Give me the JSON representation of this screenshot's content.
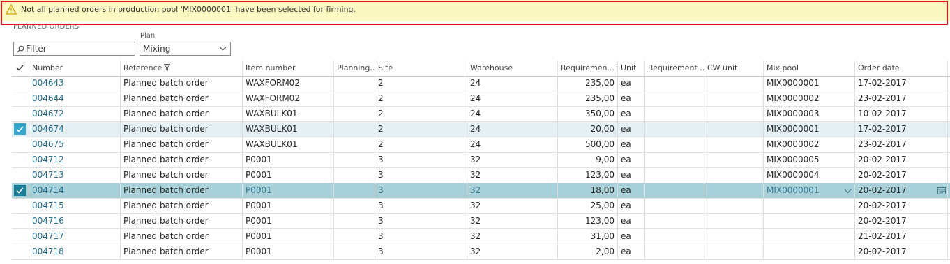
{
  "banner": {
    "message": "Not all planned orders in production pool 'MIX0000001' have been selected for firming."
  },
  "section_title": "PLANNED ORDERS",
  "filter": {
    "placeholder": "Filter",
    "value": ""
  },
  "plan": {
    "label": "Plan",
    "value": "Mixing"
  },
  "columns": {
    "number": "Number",
    "reference": "Reference",
    "item_number": "Item number",
    "planning": "Planning...",
    "site": "Site",
    "warehouse": "Warehouse",
    "requirement_qty": "Requiremen...",
    "unit": "Unit",
    "requirement_date": "Requirement ...",
    "cw_unit": "CW unit",
    "mix_pool": "Mix pool",
    "order_date": "Order date"
  },
  "rows": [
    {
      "number": "004643",
      "reference": "Planned batch order",
      "item": "WAXFORM02",
      "planning": "",
      "site": "2",
      "warehouse": "24",
      "qty": "235,00",
      "unit": "ea",
      "req": "",
      "cw": "",
      "mix": "MIX0000001",
      "date": "17-02-2017",
      "selected": false
    },
    {
      "number": "004644",
      "reference": "Planned batch order",
      "item": "WAXFORM02",
      "planning": "",
      "site": "2",
      "warehouse": "24",
      "qty": "235,00",
      "unit": "ea",
      "req": "",
      "cw": "",
      "mix": "MIX0000002",
      "date": "23-02-2017",
      "selected": false
    },
    {
      "number": "004672",
      "reference": "Planned batch order",
      "item": "WAXBULK01",
      "planning": "",
      "site": "2",
      "warehouse": "24",
      "qty": "350,00",
      "unit": "ea",
      "req": "",
      "cw": "",
      "mix": "MIX0000003",
      "date": "10-02-2017",
      "selected": false
    },
    {
      "number": "004674",
      "reference": "Planned batch order",
      "item": "WAXBULK01",
      "planning": "",
      "site": "2",
      "warehouse": "24",
      "qty": "20,00",
      "unit": "ea",
      "req": "",
      "cw": "",
      "mix": "MIX0000001",
      "date": "17-02-2017",
      "selected": true
    },
    {
      "number": "004675",
      "reference": "Planned batch order",
      "item": "WAXBULK01",
      "planning": "",
      "site": "2",
      "warehouse": "24",
      "qty": "500,00",
      "unit": "ea",
      "req": "",
      "cw": "",
      "mix": "MIX0000002",
      "date": "23-02-2017",
      "selected": false
    },
    {
      "number": "004712",
      "reference": "Planned batch order",
      "item": "P0001",
      "planning": "",
      "site": "3",
      "warehouse": "32",
      "qty": "9,00",
      "unit": "ea",
      "req": "",
      "cw": "",
      "mix": "MIX0000005",
      "date": "20-02-2017",
      "selected": false
    },
    {
      "number": "004713",
      "reference": "Planned batch order",
      "item": "P0001",
      "planning": "",
      "site": "3",
      "warehouse": "32",
      "qty": "123,00",
      "unit": "ea",
      "req": "",
      "cw": "",
      "mix": "MIX0000004",
      "date": "20-02-2017",
      "selected": false
    },
    {
      "number": "004714",
      "reference": "Planned batch order",
      "item": "P0001",
      "planning": "",
      "site": "3",
      "warehouse": "32",
      "qty": "18,00",
      "unit": "ea",
      "req": "",
      "cw": "",
      "mix": "MIX0000001",
      "date": "20-02-2017",
      "selected": true,
      "active": true
    },
    {
      "number": "004715",
      "reference": "Planned batch order",
      "item": "P0001",
      "planning": "",
      "site": "3",
      "warehouse": "32",
      "qty": "25,00",
      "unit": "ea",
      "req": "",
      "cw": "",
      "mix": "",
      "date": "20-02-2017",
      "selected": false
    },
    {
      "number": "004716",
      "reference": "Planned batch order",
      "item": "P0001",
      "planning": "",
      "site": "3",
      "warehouse": "32",
      "qty": "123,00",
      "unit": "ea",
      "req": "",
      "cw": "",
      "mix": "",
      "date": "20-02-2017",
      "selected": false
    },
    {
      "number": "004717",
      "reference": "Planned batch order",
      "item": "P0001",
      "planning": "",
      "site": "3",
      "warehouse": "32",
      "qty": "31,00",
      "unit": "ea",
      "req": "",
      "cw": "",
      "mix": "",
      "date": "21-02-2017",
      "selected": false
    },
    {
      "number": "004718",
      "reference": "Planned batch order",
      "item": "P0001",
      "planning": "",
      "site": "3",
      "warehouse": "32",
      "qty": "2,00",
      "unit": "ea",
      "req": "",
      "cw": "",
      "mix": "",
      "date": "20-02-2017",
      "selected": false
    }
  ],
  "colors": {
    "banner_bg": "#fcf8c2",
    "banner_border": "#e81123",
    "link": "#1f6b8a",
    "selected_row": "#e4f0f3",
    "active_row": "#a9d1da",
    "check_light": "#35a6cd",
    "check_dark": "#1b7a95"
  },
  "icons": [
    "warning-icon",
    "search-icon",
    "chevron-down-icon",
    "check-icon",
    "filter-icon",
    "calendar-icon"
  ]
}
